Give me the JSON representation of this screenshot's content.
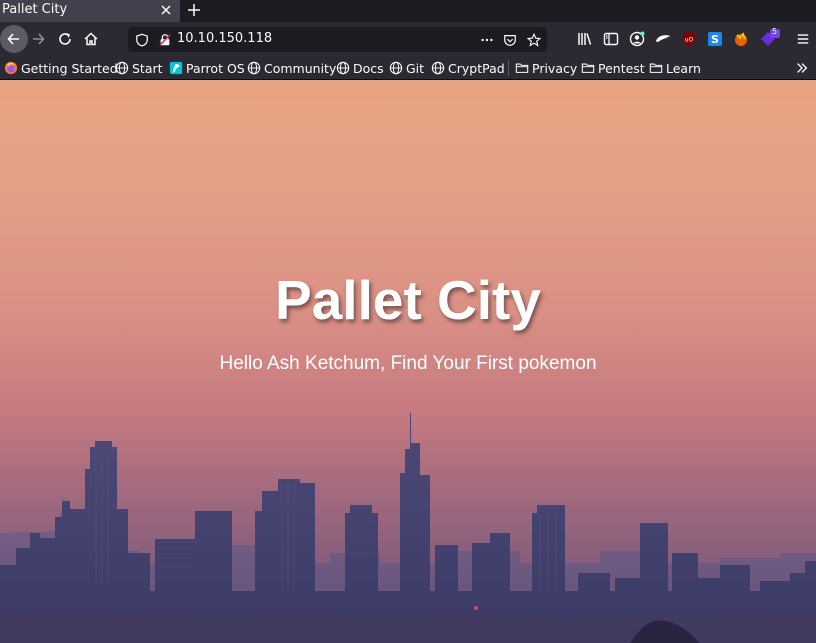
{
  "browser": {
    "tab": {
      "title": "Pallet City"
    },
    "url": "10.10.150.118",
    "extension_badge": "5"
  },
  "bookmarks": [
    {
      "label": "Getting Started",
      "icon": "firefox-icon"
    },
    {
      "label": "Start",
      "icon": "globe-icon"
    },
    {
      "label": "Parrot OS",
      "icon": "parrot-icon"
    },
    {
      "label": "Community",
      "icon": "globe-icon"
    },
    {
      "label": "Docs",
      "icon": "globe-icon"
    },
    {
      "label": "Git",
      "icon": "globe-icon"
    },
    {
      "label": "CryptPad",
      "icon": "globe-icon"
    },
    {
      "label": "Privacy",
      "icon": "folder-icon"
    },
    {
      "label": "Pentest",
      "icon": "folder-icon"
    },
    {
      "label": "Learn",
      "icon": "folder-icon"
    }
  ],
  "page": {
    "title": "Pallet City",
    "subtitle": "Hello Ash Ketchum, Find Your First pokemon"
  },
  "colors": {
    "sky_top": "#e9a383",
    "sky_bottom": "#715777",
    "toolbar": "#2b2a33"
  }
}
